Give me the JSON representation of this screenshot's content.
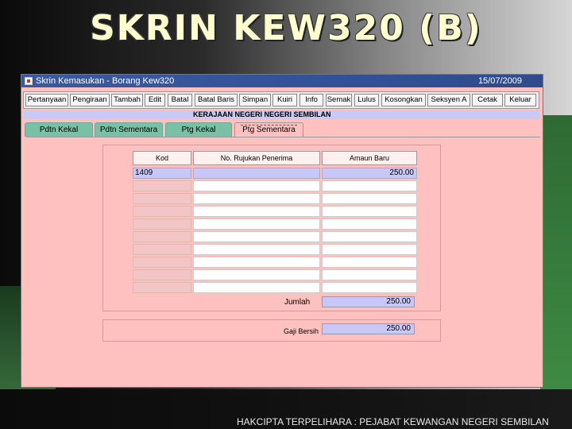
{
  "slide": {
    "title": "SKRIN KEW320 (B)",
    "footer": "HAKCIPTA TERPELIHARA : PEJABAT KEWANGAN NEGERI SEMBILAN"
  },
  "window": {
    "title": "Skrin Kemasukan - Borang Kew320",
    "date": "15/07/2009",
    "icon": "app-window-icon"
  },
  "toolbar": {
    "buttons": [
      "Pertanyaan",
      "Pengiraan",
      "Tambah",
      "Edit",
      "Batal",
      "Batal Baris",
      "Simpan",
      "Kuiri",
      "Info",
      "Semak",
      "Lulus",
      "Kosongkan",
      "Seksyen A",
      "Cetak",
      "Keluar"
    ]
  },
  "banner": "KERAJAAN NEGERI NEGERI SEMBILAN",
  "tabs": [
    "Pdtn Kekal",
    "Pdtn Sementara",
    "Ptg Kekal",
    "Ptg Sementara"
  ],
  "active_tab": "Ptg Sementara",
  "table": {
    "columns": [
      "Kod",
      "No. Rujukan Penerima",
      "Amaun Baru"
    ],
    "rows": [
      {
        "kod": "1409",
        "rujukan": "",
        "amaun": "250.00"
      },
      {
        "kod": "",
        "rujukan": "",
        "amaun": ""
      },
      {
        "kod": "",
        "rujukan": "",
        "amaun": ""
      },
      {
        "kod": "",
        "rujukan": "",
        "amaun": ""
      },
      {
        "kod": "",
        "rujukan": "",
        "amaun": ""
      },
      {
        "kod": "",
        "rujukan": "",
        "amaun": ""
      },
      {
        "kod": "",
        "rujukan": "",
        "amaun": ""
      },
      {
        "kod": "",
        "rujukan": "",
        "amaun": ""
      },
      {
        "kod": "",
        "rujukan": "",
        "amaun": ""
      },
      {
        "kod": "",
        "rujukan": "",
        "amaun": ""
      }
    ]
  },
  "totals": {
    "jumlah_label": "Jumlah",
    "jumlah_value": "250.00",
    "gaji_label": "Gaji Bersih",
    "gaji_value": "250.00"
  }
}
